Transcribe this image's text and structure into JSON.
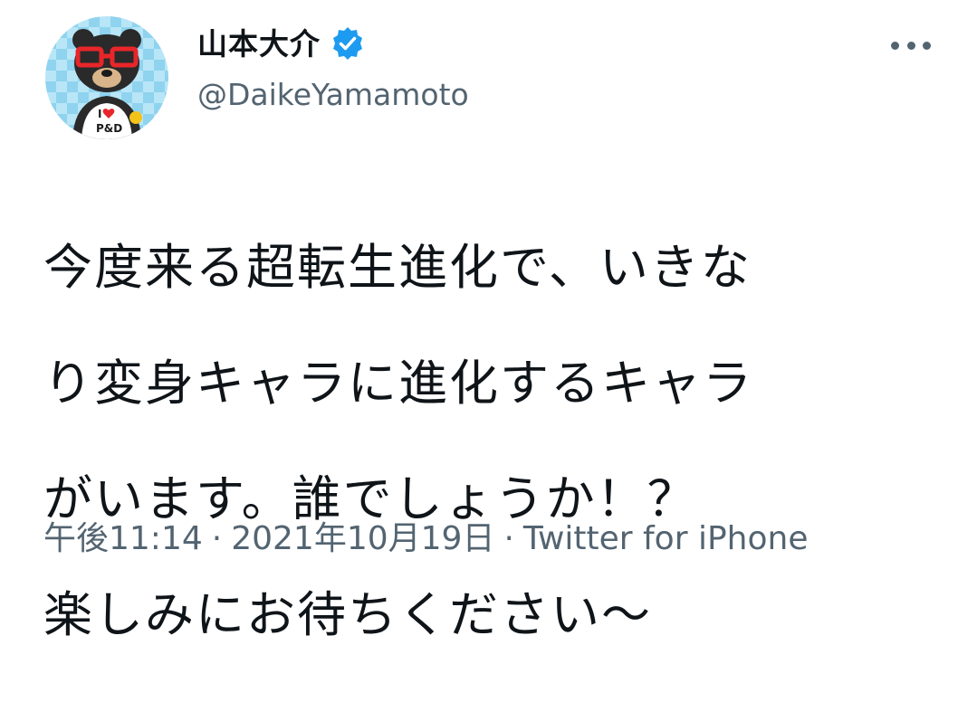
{
  "user": {
    "display_name": "山本大介",
    "handle": "@DaikeYamamoto",
    "verified": true,
    "avatar_icon": "bear-mascot-avatar",
    "verified_icon": "verified-badge-icon",
    "badge_color": "#1d9bf0"
  },
  "menu": {
    "icon": "more-options-icon"
  },
  "tweet": {
    "text_lines": [
      "今度来る超転生進化で、いきな",
      "り変身キャラに進化するキャラ",
      "がいます。誰でしょうか！？",
      "楽しみにお待ちください〜"
    ]
  },
  "meta": {
    "time": "午後11:14",
    "date": "2021年10月19日",
    "source": "Twitter for iPhone",
    "separator": "·"
  }
}
